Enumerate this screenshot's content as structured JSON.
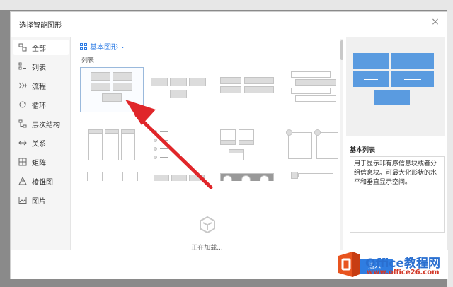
{
  "dialog": {
    "title": "选择智能图形",
    "close_glyph": "×"
  },
  "sidebar": {
    "items": [
      {
        "label": "全部",
        "icon": "all-icon"
      },
      {
        "label": "列表",
        "icon": "list-icon"
      },
      {
        "label": "流程",
        "icon": "process-icon"
      },
      {
        "label": "循环",
        "icon": "cycle-icon"
      },
      {
        "label": "层次结构",
        "icon": "hierarchy-icon"
      },
      {
        "label": "关系",
        "icon": "relationship-icon"
      },
      {
        "label": "矩阵",
        "icon": "matrix-icon"
      },
      {
        "label": "棱锥图",
        "icon": "pyramid-icon"
      },
      {
        "label": "图片",
        "icon": "picture-icon"
      }
    ],
    "active_index": 0
  },
  "main": {
    "heading": "基本图形",
    "section_label": "列表",
    "loading_text": "正在加载..."
  },
  "preview": {
    "title": "基本列表",
    "description": "用于显示非有序信息块或者分组信息块。可最大化形状的水平和垂直显示空间。"
  },
  "footer": {
    "insert_label": "插入"
  },
  "watermark": {
    "text1": "Office教程网",
    "text2": "www.office26.com"
  },
  "colors": {
    "accent": "#2c7be5",
    "preview_block": "#5a9be0",
    "arrow": "#e0262a"
  }
}
